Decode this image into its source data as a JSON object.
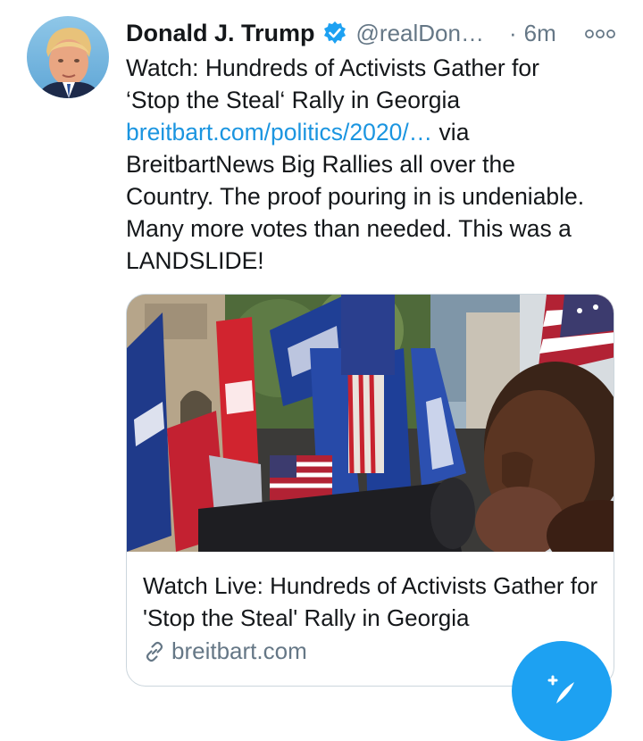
{
  "tweet": {
    "author_name": "Donald J. Trump",
    "handle": "@realDon…",
    "separator": "·",
    "time": "6m",
    "text_lines": [
      "Watch: Hundreds of Activists Gather for",
      "‘Stop the Steal‘ Rally in Georgia"
    ],
    "link_text": "breitbart.com/politics/2020/…",
    "text_after_link": " via",
    "text_lines_2": [
      "BreitbartNews  Big Rallies all over the",
      "Country. The proof pouring in is undeniable.",
      "Many more votes than needed. This was a",
      "LANDSLIDE!"
    ]
  },
  "card": {
    "title": "Watch Live: Hundreds of Activists Gather for 'Stop the Steal' Rally in Georgia",
    "domain": "breitbart.com"
  },
  "icons": {
    "verified": "verified-badge-icon",
    "more": "more-options-icon",
    "link": "link-icon",
    "compose": "compose-tweet-icon"
  },
  "colors": {
    "link": "#1b95e0",
    "secondary_text": "#657786",
    "fab": "#1da1f2",
    "card_border": "#ccd6dd"
  }
}
